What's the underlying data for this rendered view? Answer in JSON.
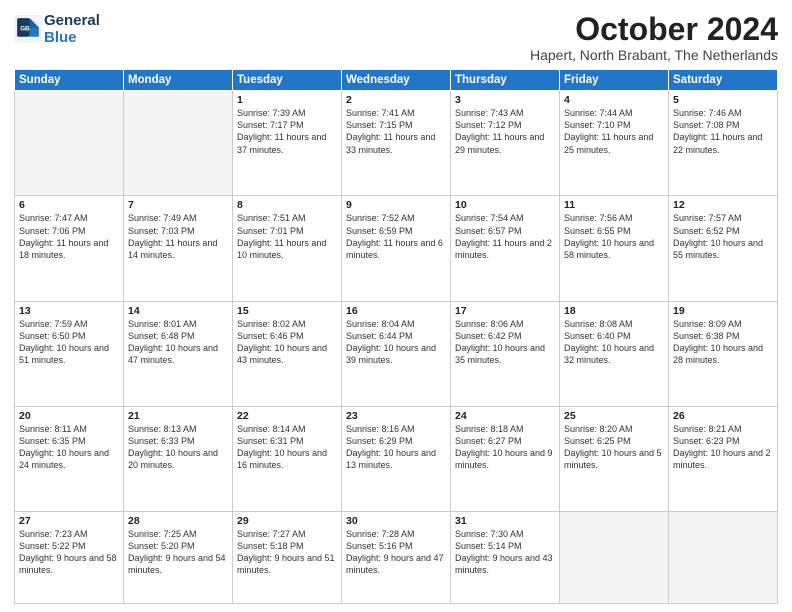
{
  "header": {
    "logo_line1": "General",
    "logo_line2": "Blue",
    "month_year": "October 2024",
    "location": "Hapert, North Brabant, The Netherlands"
  },
  "weekdays": [
    "Sunday",
    "Monday",
    "Tuesday",
    "Wednesday",
    "Thursday",
    "Friday",
    "Saturday"
  ],
  "weeks": [
    [
      {
        "day": "",
        "info": ""
      },
      {
        "day": "",
        "info": ""
      },
      {
        "day": "1",
        "info": "Sunrise: 7:39 AM\nSunset: 7:17 PM\nDaylight: 11 hours and 37 minutes."
      },
      {
        "day": "2",
        "info": "Sunrise: 7:41 AM\nSunset: 7:15 PM\nDaylight: 11 hours and 33 minutes."
      },
      {
        "day": "3",
        "info": "Sunrise: 7:43 AM\nSunset: 7:12 PM\nDaylight: 11 hours and 29 minutes."
      },
      {
        "day": "4",
        "info": "Sunrise: 7:44 AM\nSunset: 7:10 PM\nDaylight: 11 hours and 25 minutes."
      },
      {
        "day": "5",
        "info": "Sunrise: 7:46 AM\nSunset: 7:08 PM\nDaylight: 11 hours and 22 minutes."
      }
    ],
    [
      {
        "day": "6",
        "info": "Sunrise: 7:47 AM\nSunset: 7:06 PM\nDaylight: 11 hours and 18 minutes."
      },
      {
        "day": "7",
        "info": "Sunrise: 7:49 AM\nSunset: 7:03 PM\nDaylight: 11 hours and 14 minutes."
      },
      {
        "day": "8",
        "info": "Sunrise: 7:51 AM\nSunset: 7:01 PM\nDaylight: 11 hours and 10 minutes."
      },
      {
        "day": "9",
        "info": "Sunrise: 7:52 AM\nSunset: 6:59 PM\nDaylight: 11 hours and 6 minutes."
      },
      {
        "day": "10",
        "info": "Sunrise: 7:54 AM\nSunset: 6:57 PM\nDaylight: 11 hours and 2 minutes."
      },
      {
        "day": "11",
        "info": "Sunrise: 7:56 AM\nSunset: 6:55 PM\nDaylight: 10 hours and 58 minutes."
      },
      {
        "day": "12",
        "info": "Sunrise: 7:57 AM\nSunset: 6:52 PM\nDaylight: 10 hours and 55 minutes."
      }
    ],
    [
      {
        "day": "13",
        "info": "Sunrise: 7:59 AM\nSunset: 6:50 PM\nDaylight: 10 hours and 51 minutes."
      },
      {
        "day": "14",
        "info": "Sunrise: 8:01 AM\nSunset: 6:48 PM\nDaylight: 10 hours and 47 minutes."
      },
      {
        "day": "15",
        "info": "Sunrise: 8:02 AM\nSunset: 6:46 PM\nDaylight: 10 hours and 43 minutes."
      },
      {
        "day": "16",
        "info": "Sunrise: 8:04 AM\nSunset: 6:44 PM\nDaylight: 10 hours and 39 minutes."
      },
      {
        "day": "17",
        "info": "Sunrise: 8:06 AM\nSunset: 6:42 PM\nDaylight: 10 hours and 35 minutes."
      },
      {
        "day": "18",
        "info": "Sunrise: 8:08 AM\nSunset: 6:40 PM\nDaylight: 10 hours and 32 minutes."
      },
      {
        "day": "19",
        "info": "Sunrise: 8:09 AM\nSunset: 6:38 PM\nDaylight: 10 hours and 28 minutes."
      }
    ],
    [
      {
        "day": "20",
        "info": "Sunrise: 8:11 AM\nSunset: 6:35 PM\nDaylight: 10 hours and 24 minutes."
      },
      {
        "day": "21",
        "info": "Sunrise: 8:13 AM\nSunset: 6:33 PM\nDaylight: 10 hours and 20 minutes."
      },
      {
        "day": "22",
        "info": "Sunrise: 8:14 AM\nSunset: 6:31 PM\nDaylight: 10 hours and 16 minutes."
      },
      {
        "day": "23",
        "info": "Sunrise: 8:16 AM\nSunset: 6:29 PM\nDaylight: 10 hours and 13 minutes."
      },
      {
        "day": "24",
        "info": "Sunrise: 8:18 AM\nSunset: 6:27 PM\nDaylight: 10 hours and 9 minutes."
      },
      {
        "day": "25",
        "info": "Sunrise: 8:20 AM\nSunset: 6:25 PM\nDaylight: 10 hours and 5 minutes."
      },
      {
        "day": "26",
        "info": "Sunrise: 8:21 AM\nSunset: 6:23 PM\nDaylight: 10 hours and 2 minutes."
      }
    ],
    [
      {
        "day": "27",
        "info": "Sunrise: 7:23 AM\nSunset: 5:22 PM\nDaylight: 9 hours and 58 minutes."
      },
      {
        "day": "28",
        "info": "Sunrise: 7:25 AM\nSunset: 5:20 PM\nDaylight: 9 hours and 54 minutes."
      },
      {
        "day": "29",
        "info": "Sunrise: 7:27 AM\nSunset: 5:18 PM\nDaylight: 9 hours and 51 minutes."
      },
      {
        "day": "30",
        "info": "Sunrise: 7:28 AM\nSunset: 5:16 PM\nDaylight: 9 hours and 47 minutes."
      },
      {
        "day": "31",
        "info": "Sunrise: 7:30 AM\nSunset: 5:14 PM\nDaylight: 9 hours and 43 minutes."
      },
      {
        "day": "",
        "info": ""
      },
      {
        "day": "",
        "info": ""
      }
    ]
  ]
}
